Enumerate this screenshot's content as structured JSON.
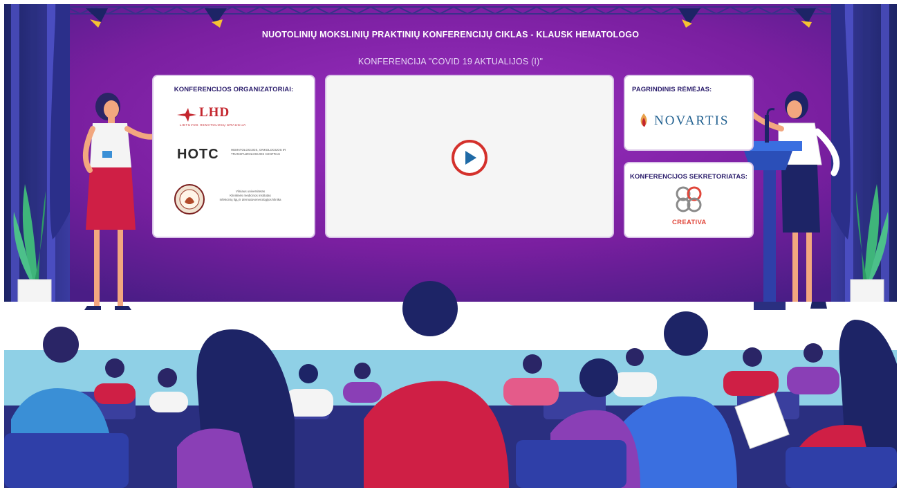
{
  "header": {
    "title": "NUOTOLINIŲ MOKSLINIŲ PRAKTINIŲ KONFERENCIJŲ CIKLAS - KLAUSK HEMATOLOGO",
    "subtitle": "KONFERENCIJA \"COVID 19 AKTUALIJOS (I)\""
  },
  "organizers": {
    "heading": "KONFERENCIJOS ORGANIZATORIAI:",
    "lhd_logo": "LHD",
    "lhd_caption": "LIETUVOS HEMATOLOGŲ DRAUGIJA",
    "hotc_logo": "HOTC",
    "hotc_caption": "HEMATOLOGIJOS, ONKOLOGIJOS IR TRANSFUZIOLOGIJOS CENTRAS",
    "vu_caption_1": "Vilniaus universitetas",
    "vu_caption_2": "Klinikinės medicinos institutas",
    "vu_caption_3": "Infekcinių ligų ir dermatovenerologijos klinika"
  },
  "video": {
    "play_icon": "play-icon"
  },
  "sponsor": {
    "heading": "PAGRINDINIS RĖMĖJAS:",
    "logo": "NOVARTIS"
  },
  "secretariat": {
    "heading": "KONFERENCIJOS SEKRETORIATAS:",
    "logo": "CREATIVA"
  },
  "colors": {
    "stage_purple": "#7a1fa0",
    "curtain_blue": "#2f2a86",
    "floor_white": "#ffffff",
    "audience_band": "#8fd0e6",
    "heading_navy": "#2a1c6b",
    "play_red": "#d4312c",
    "play_blue": "#1f6aa6"
  }
}
